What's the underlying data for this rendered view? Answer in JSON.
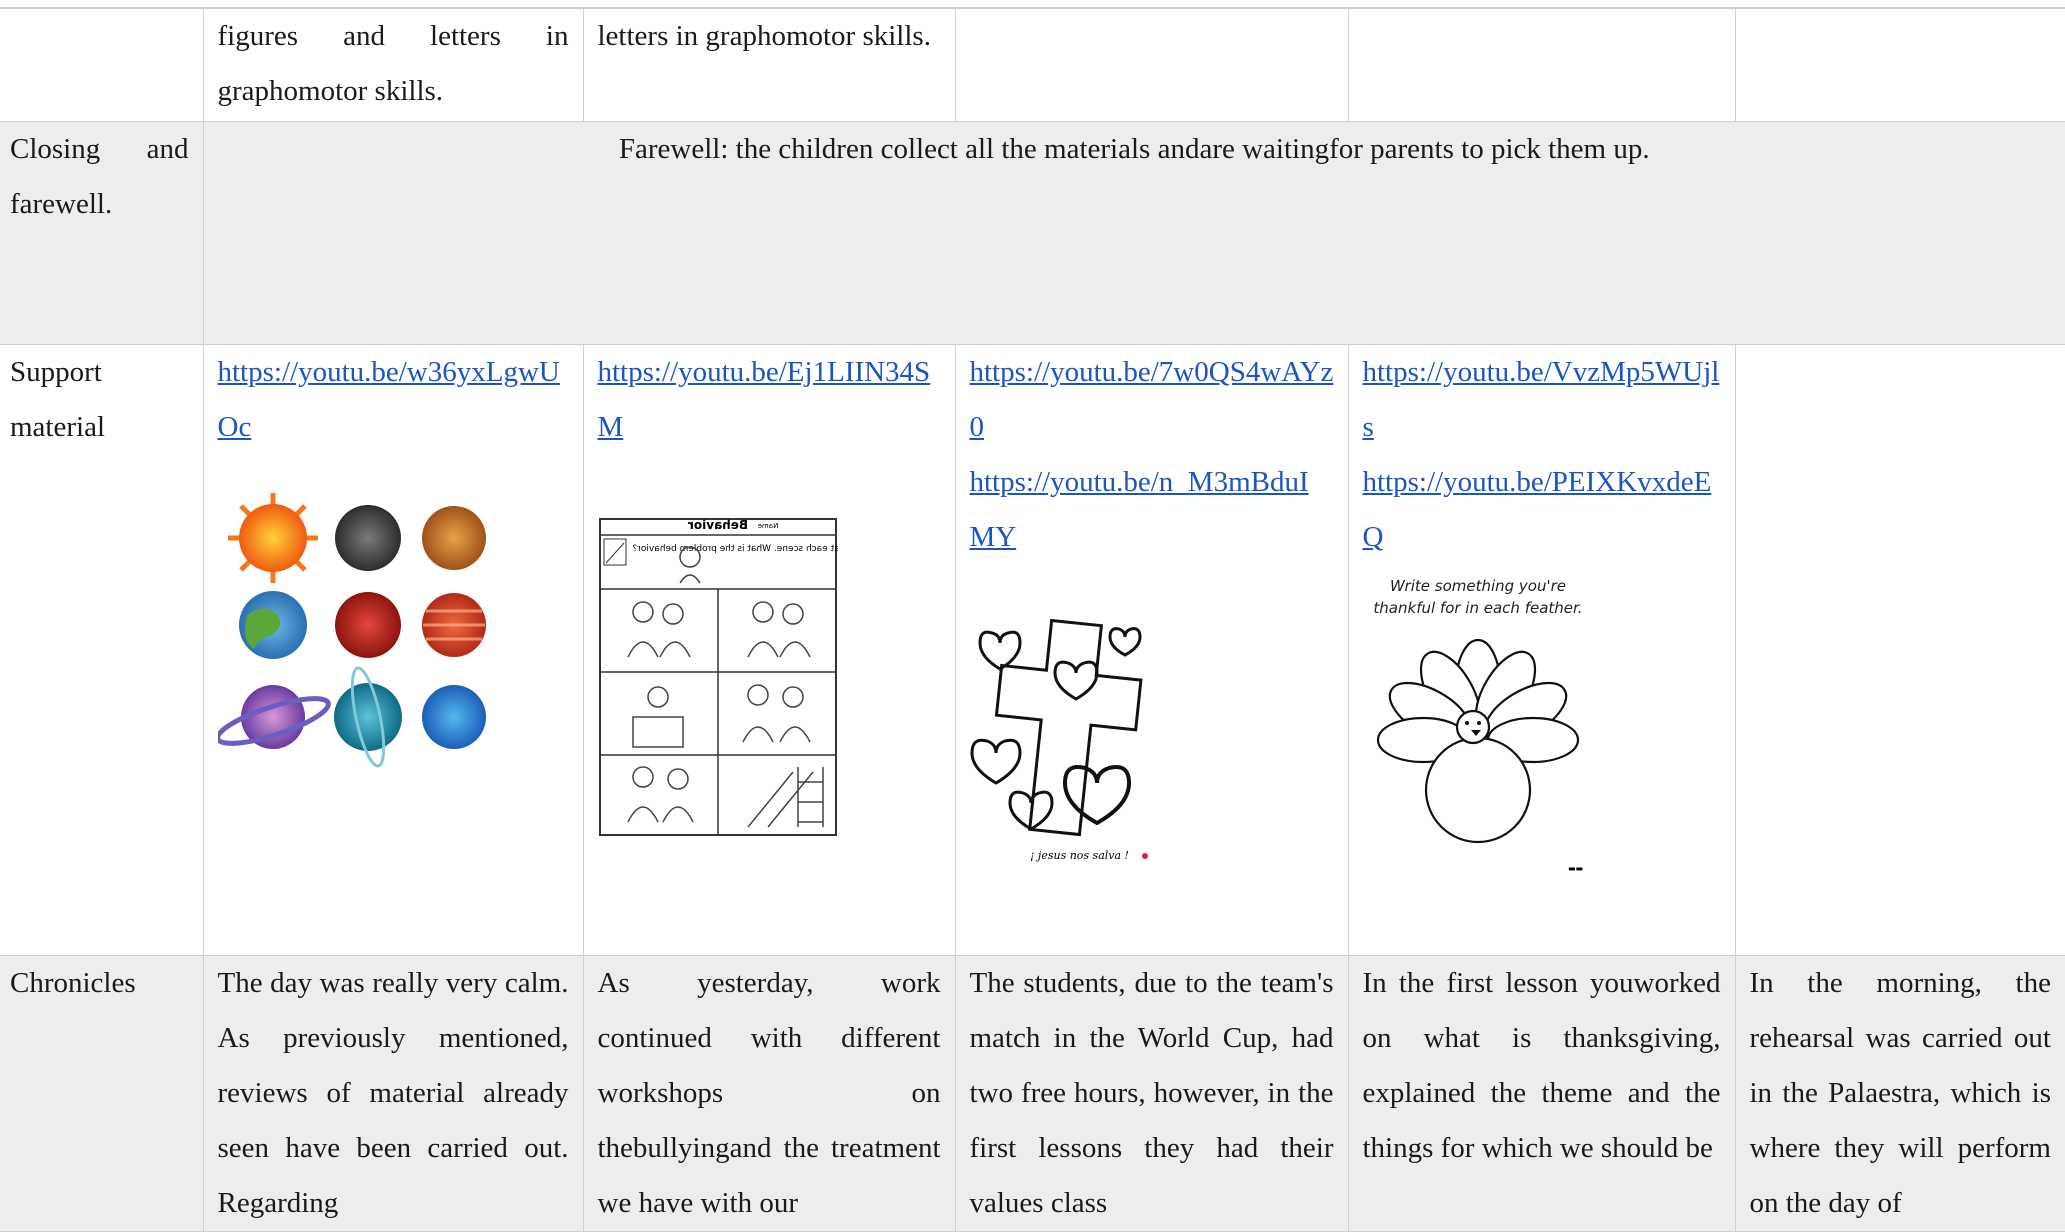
{
  "top_row": {
    "c1": "",
    "c2": "figures and letters in graphomotor skills.",
    "c3": "letters in graphomotor skills.",
    "c4": "",
    "c5": "",
    "c6": ""
  },
  "closing": {
    "label": "Closing and farewell.",
    "text": "Farewell: the children collect all the materials andare waitingfor parents to pick them up."
  },
  "support": {
    "label": "Support material",
    "day1": {
      "links": [
        "https://youtu.be/w36yxLgwUOc"
      ]
    },
    "day2": {
      "links": [
        "https://youtu.be/Ej1LIIN34SM"
      ],
      "worksheet_title": "Behavior",
      "worksheet_name_box": "Name",
      "worksheet_prompt": "Look at each scene. What is the problem behavior?"
    },
    "day3": {
      "links": [
        "https://youtu.be/7w0QS4wAYz0",
        "https://youtu.be/n_M3mBduIMY"
      ],
      "caption": "¡ jesus nos salva !"
    },
    "day4": {
      "links": [
        "https://youtu.be/VvzMp5WUjls",
        "https://youtu.be/PEIXKvxdeEQ"
      ],
      "prompt": "Write something you're thankful for in each feather."
    },
    "day5": {
      "links": []
    }
  },
  "chronicles": {
    "label": "Chronicles",
    "day1": "The day was really very calm. As previously mentioned, reviews of material already seen have been carried out. Regarding",
    "day2": "As yesterday, work continued with different workshops on thebullyingand the treatment we have with our",
    "day3": "The students, due to the team's match in the World Cup, had two free hours, however, in the first lessons they had their values class",
    "day4": "In the first lesson youworked on what is thanksgiving, explained the theme and the things for which we should be",
    "day5": "In the morning, the rehearsal was carried out in the Palaestra, which is where they will perform on the day of"
  },
  "planets": [
    "Sun",
    "Mercury",
    "Venus",
    "Earth",
    "Mars",
    "Jupiter",
    "Saturn",
    "Uranus",
    "Neptune"
  ],
  "colors": {
    "link": "#1a55c4",
    "row_gray": "#ededed",
    "border": "#cfcfcf"
  }
}
